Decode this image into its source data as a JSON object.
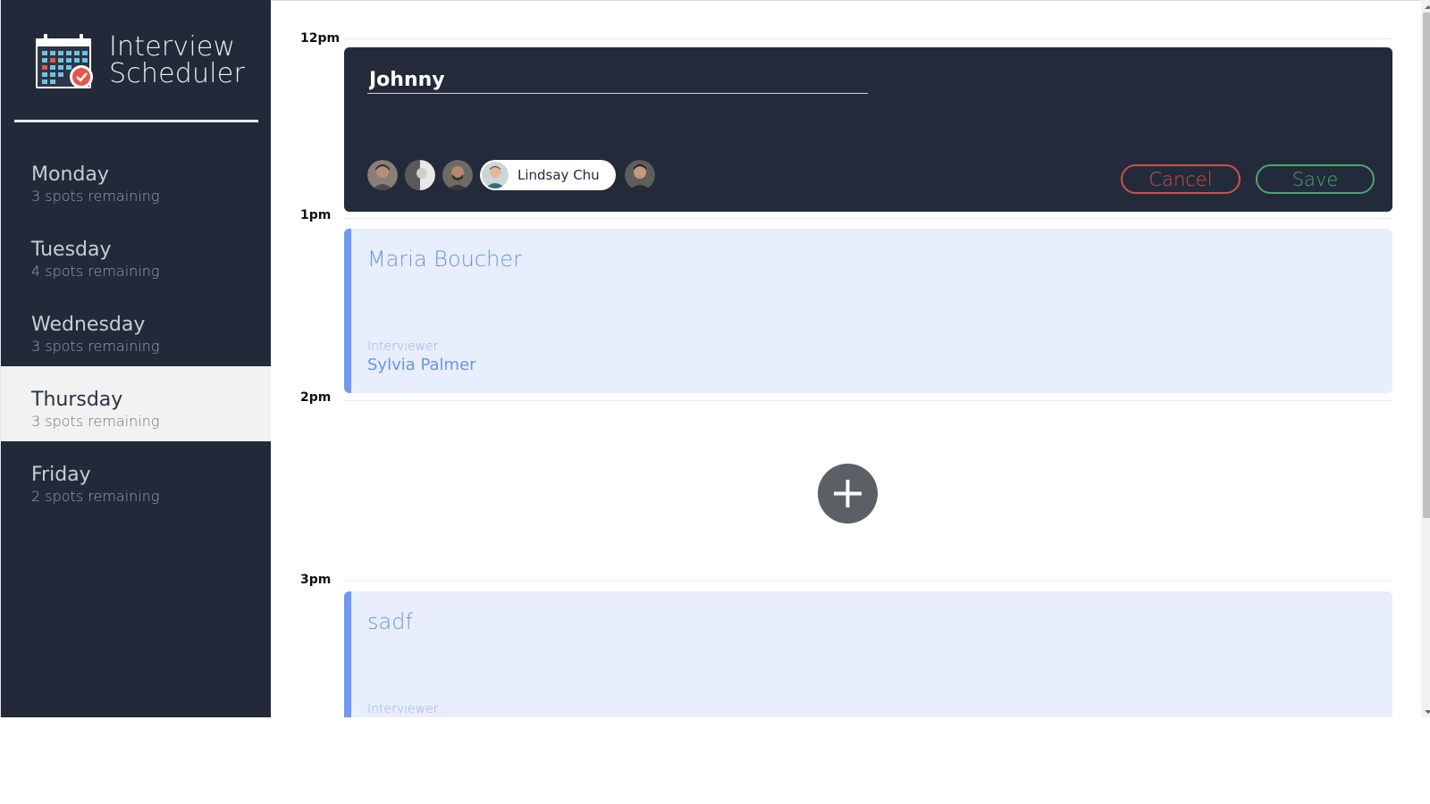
{
  "app": {
    "brand_line1": "Interview",
    "brand_line2": "Scheduler",
    "logo_icon": "calendar-check-icon"
  },
  "sidebar": {
    "days": [
      {
        "name": "Monday",
        "spots": "3 spots remaining",
        "selected": false
      },
      {
        "name": "Tuesday",
        "spots": "4 spots remaining",
        "selected": false
      },
      {
        "name": "Wednesday",
        "spots": "3 spots remaining",
        "selected": false
      },
      {
        "name": "Thursday",
        "spots": "3 spots remaining",
        "selected": true
      },
      {
        "name": "Friday",
        "spots": "2 spots remaining",
        "selected": false
      }
    ]
  },
  "schedule": {
    "times": [
      "12pm",
      "1pm",
      "2pm",
      "3pm"
    ],
    "form": {
      "student_value": "Johnny",
      "selected_interviewer": "Lindsay Chu",
      "cancel_label": "Cancel",
      "save_label": "Save"
    },
    "appointments": [
      {
        "student": "Maria Boucher",
        "label": "Interviewer",
        "interviewer": "Sylvia Palmer"
      },
      {
        "student": "sadf",
        "label": "Interviewer",
        "interviewer": ""
      }
    ],
    "add_icon": "plus-icon"
  },
  "colors": {
    "sidebar_bg": "#222a39",
    "selected_day_bg": "#f2f2f2",
    "appointment_bg": "#e8eefb",
    "appointment_accent": "#6f98f3",
    "cancel": "#d24f4f",
    "save": "#4fa46e"
  }
}
